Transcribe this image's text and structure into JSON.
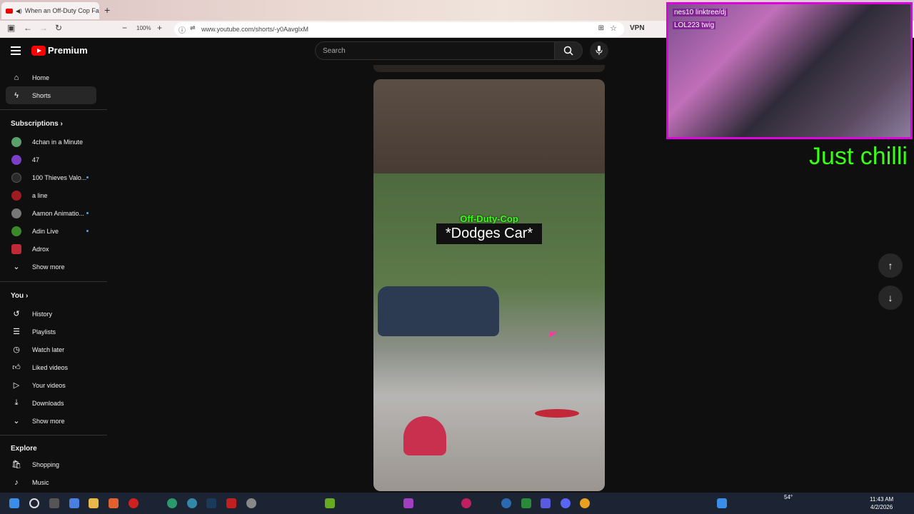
{
  "browser": {
    "tab_title": "When an Off-Duty Cop Fac",
    "url": "www.youtube.com/shorts/-y0AavgIxM",
    "zoom": "100%",
    "vpn_label": "VPN"
  },
  "header": {
    "logo_text": "Premium",
    "search_placeholder": "Search"
  },
  "sidebar": {
    "main": [
      {
        "label": "Home",
        "icon": "home-icon"
      },
      {
        "label": "Shorts",
        "icon": "shorts-icon",
        "active": true
      }
    ],
    "subscriptions_title": "Subscriptions",
    "subscriptions": [
      {
        "label": "4chan in a Minute",
        "color": "#5aa06a"
      },
      {
        "label": "47",
        "color": "#7a3ec8"
      },
      {
        "label": "100 Thieves Valo...",
        "color": "#2a2a2a",
        "new": true
      },
      {
        "label": "a line",
        "color": "#a01b22"
      },
      {
        "label": "Aamon Animatio...",
        "color": "#777777",
        "new": true
      },
      {
        "label": "Adin Live",
        "color": "#3a8a2a",
        "new": true
      },
      {
        "label": "Adrox",
        "color": "#c02a36"
      }
    ],
    "subs_show_more": "Show more",
    "you_title": "You",
    "you_items": [
      {
        "label": "History",
        "icon": "history-icon"
      },
      {
        "label": "Playlists",
        "icon": "playlists-icon"
      },
      {
        "label": "Watch later",
        "icon": "watch-later-icon"
      },
      {
        "label": "Liked videos",
        "icon": "liked-icon"
      },
      {
        "label": "Your videos",
        "icon": "your-videos-icon"
      },
      {
        "label": "Downloads",
        "icon": "downloads-icon"
      }
    ],
    "you_show_more": "Show more",
    "explore_title": "Explore",
    "explore_items": [
      {
        "label": "Shopping",
        "icon": "shopping-icon"
      },
      {
        "label": "Music",
        "icon": "music-icon"
      }
    ]
  },
  "video": {
    "caption_top": "Off-Duty-Cop",
    "caption_main": "*Dodges Car*"
  },
  "overlay": {
    "cam_line1": "nes10 linktree/dj",
    "cam_line2": "LOL223 twig",
    "ticker": "Just chilli"
  },
  "taskbar": {
    "time": "11:43 AM",
    "date": "4/2/2026",
    "temp": "54°"
  }
}
